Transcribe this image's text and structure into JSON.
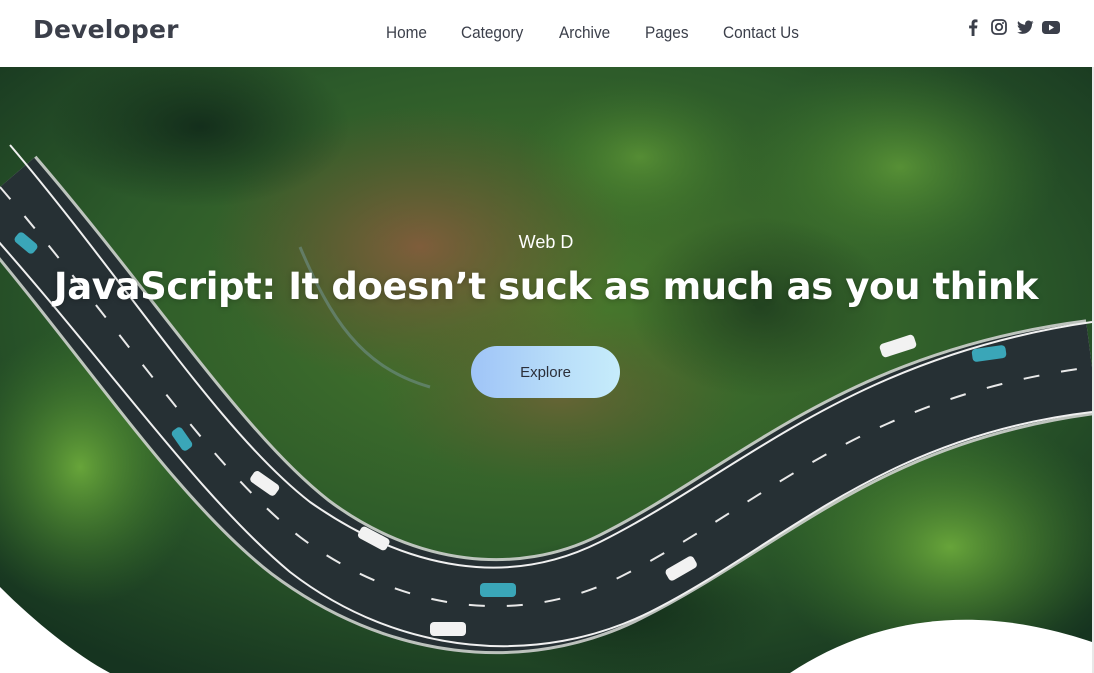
{
  "header": {
    "logo": "Developer",
    "nav": [
      "Home",
      "Category",
      "Archive",
      "Pages",
      "Contact Us"
    ],
    "social_icons": [
      "facebook-icon",
      "instagram-icon",
      "twitter-icon",
      "youtube-icon"
    ]
  },
  "hero": {
    "category": "Web D",
    "title": "JavaScript: It doesn’t suck as much as you think",
    "button_label": "Explore",
    "background": "aerial photo of a winding road through a forest",
    "colors": {
      "forest_dark": "#1e3a22",
      "forest_green": "#3f7a2e",
      "road": "#2c3438",
      "button_gradient_start": "#9fc4f7",
      "button_gradient_end": "#c6ecfb"
    }
  }
}
